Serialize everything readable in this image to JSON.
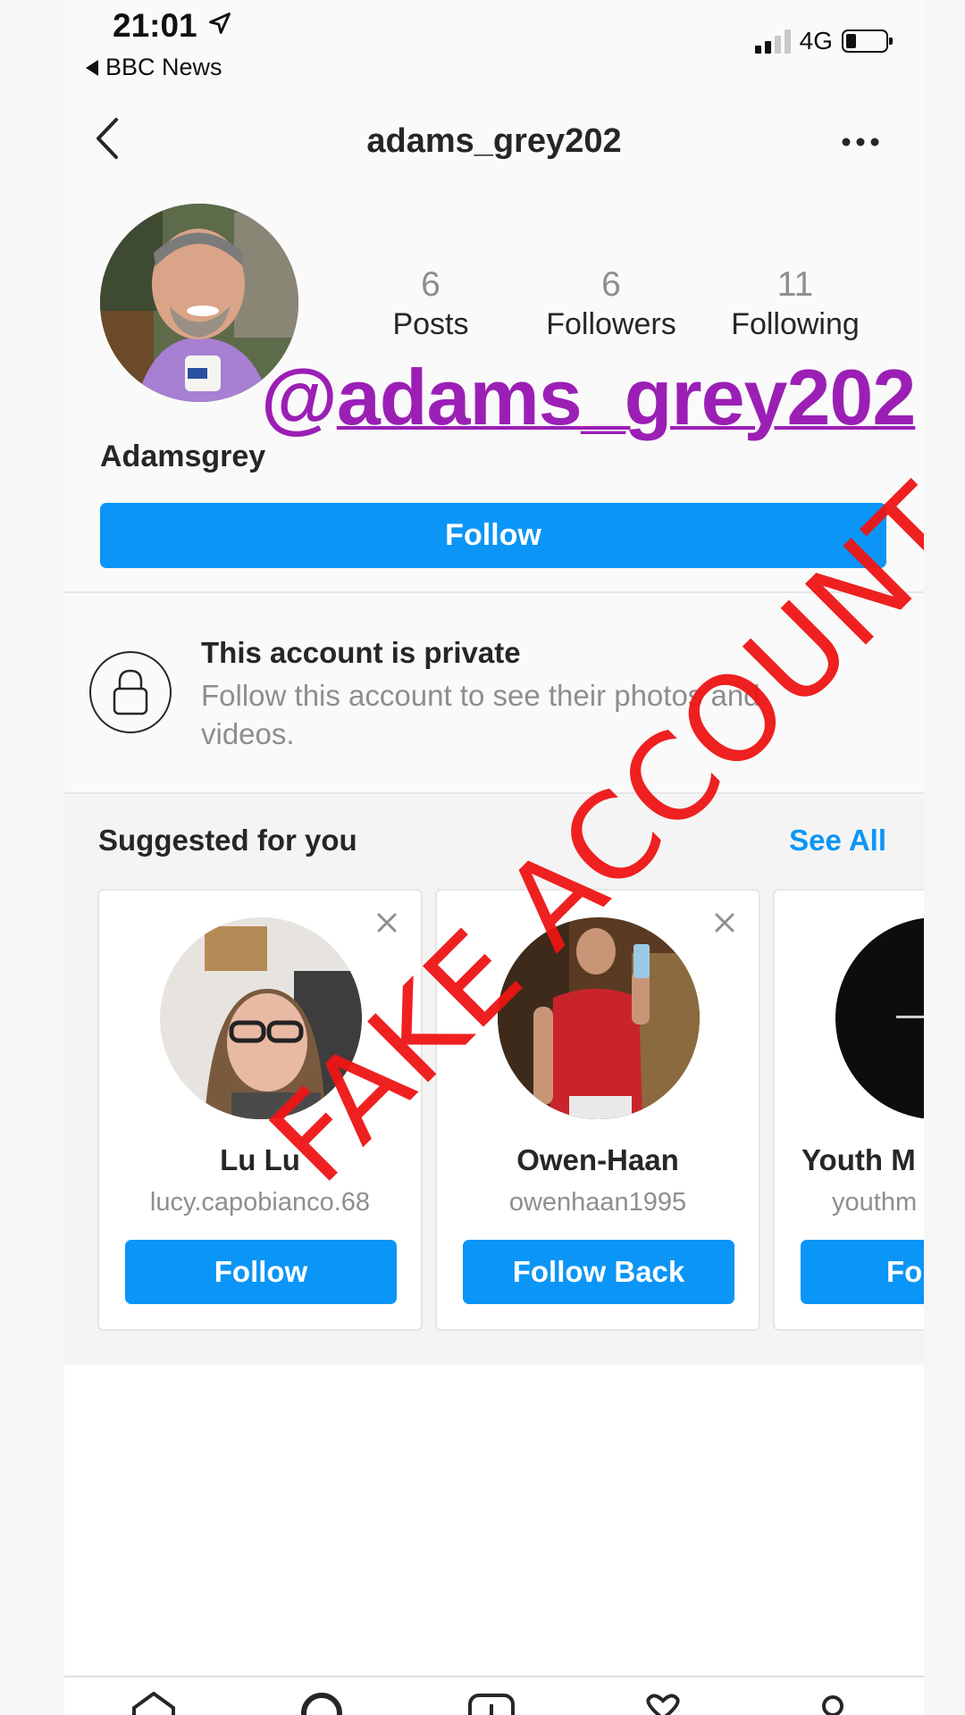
{
  "status_bar": {
    "time": "21:01",
    "back_app": "BBC News",
    "network": "4G",
    "battery_level": 0.25
  },
  "header": {
    "username": "adams_grey202"
  },
  "profile": {
    "posts_count": "6",
    "posts_label": "Posts",
    "followers_count": "6",
    "followers_label": "Followers",
    "following_count": "11",
    "following_label": "Following",
    "display_name": "Adamsgrey",
    "follow_label": "Follow"
  },
  "overlay": {
    "handle_at": "@",
    "handle_rest": "adams_grey202",
    "stamp": "FAKE ACCOUNT",
    "handle_color": "#9b1fb5",
    "stamp_color": "#ee1414"
  },
  "private_notice": {
    "title": "This account is private",
    "subtitle": "Follow this account to see their photos and videos."
  },
  "suggested": {
    "title": "Suggested for you",
    "see_all": "See All",
    "cards": [
      {
        "name": "Lu Lu",
        "username": "lucy.capobianco.68",
        "button": "Follow"
      },
      {
        "name": "Owen-Haan",
        "username": "owenhaan1995",
        "button": "Follow Back"
      },
      {
        "name": "Youth M",
        "username": "youthm",
        "button": "Fo"
      }
    ]
  },
  "colors": {
    "accent": "#0b95f6",
    "text": "#262626",
    "secondary_text": "#8e8e8e"
  },
  "icons": {
    "back": "chevron-left-icon",
    "more": "more-horizontal-icon",
    "lock": "lock-icon",
    "close": "close-icon",
    "tabs": [
      "home-icon",
      "search-icon",
      "add-post-icon",
      "heart-icon",
      "profile-icon"
    ]
  }
}
